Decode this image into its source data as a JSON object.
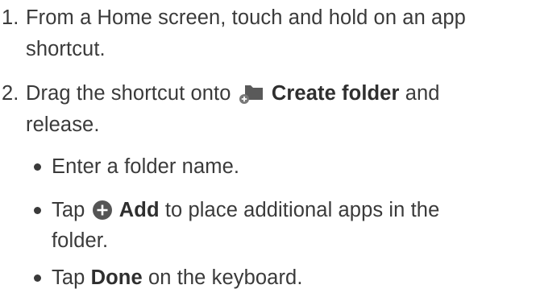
{
  "steps": [
    {
      "number": "1.",
      "line1": "From a Home screen, touch and hold on an app",
      "line2": "shortcut."
    },
    {
      "number": "2.",
      "before": "Drag the shortcut onto",
      "bold": "Create folder",
      "after": "and",
      "line2": "release.",
      "icon": "create-folder-icon",
      "substeps": [
        {
          "text": "Enter a folder name."
        },
        {
          "before": "Tap",
          "bold": "Add",
          "after": "to place additional apps in the",
          "line2": "folder.",
          "icon": "add-icon"
        },
        {
          "before": "Tap",
          "bold": "Done",
          "after": "on the keyboard."
        }
      ]
    }
  ],
  "colors": {
    "text": "#3a3a3a",
    "folder_icon": "#5a5a5a",
    "add_icon": "#555555",
    "create_folder_badge": "#777777"
  }
}
